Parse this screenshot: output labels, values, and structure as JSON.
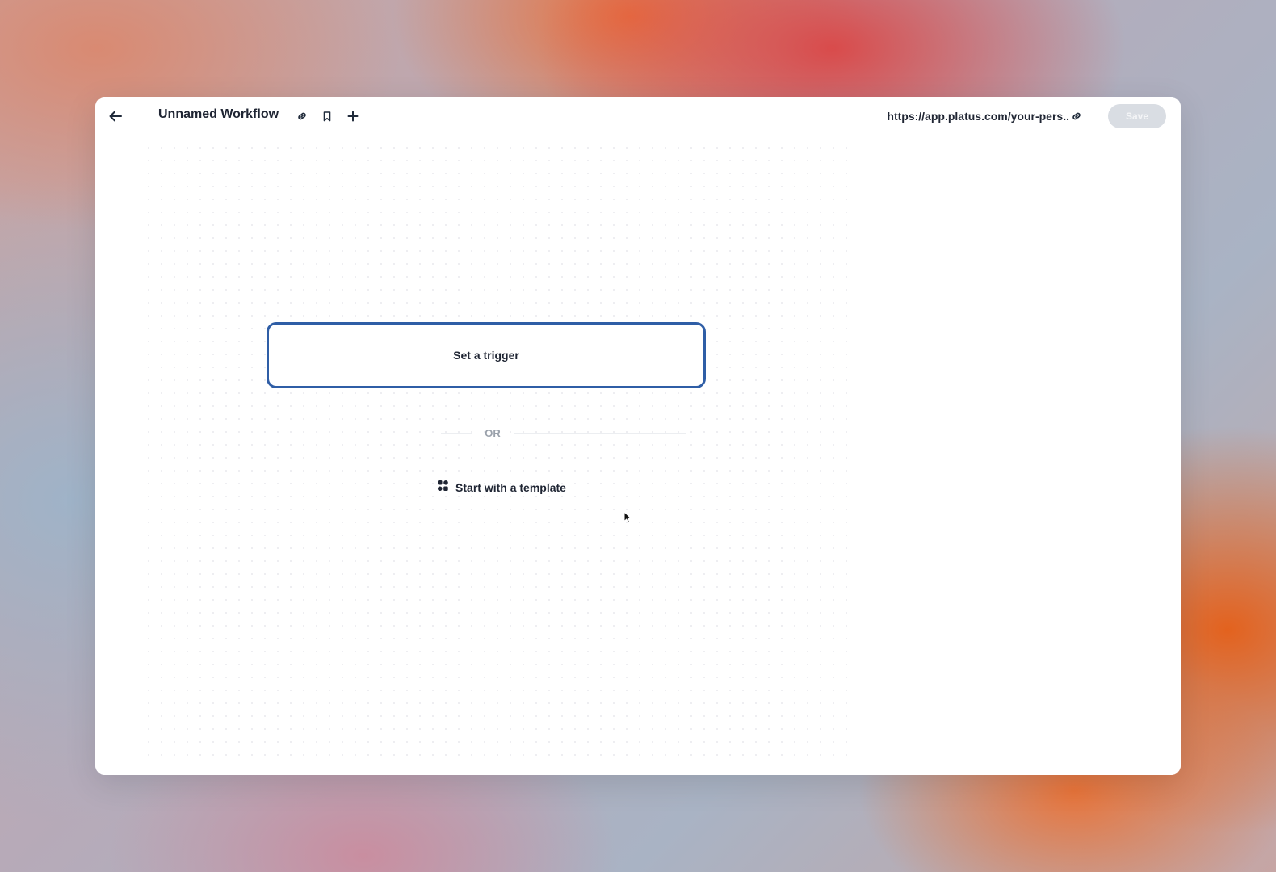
{
  "header": {
    "back_icon": "arrow-left-icon",
    "title": "Unnamed Workflow",
    "title_actions": [
      "link-icon",
      "bookmark-icon",
      "plus-icon"
    ],
    "url": "https://app.platus.com/your-pers..",
    "url_icon": "link-icon",
    "save_label": "Save"
  },
  "canvas": {
    "trigger_label": "Set a trigger",
    "or_label": "OR",
    "template_label": "Start with a template",
    "template_icon": "apps-grid-icon"
  },
  "colors": {
    "accent_border": "#2f5ea6",
    "text_primary": "#1f2533",
    "muted": "#9aa1ab",
    "save_disabled_bg": "#d9dde3"
  }
}
